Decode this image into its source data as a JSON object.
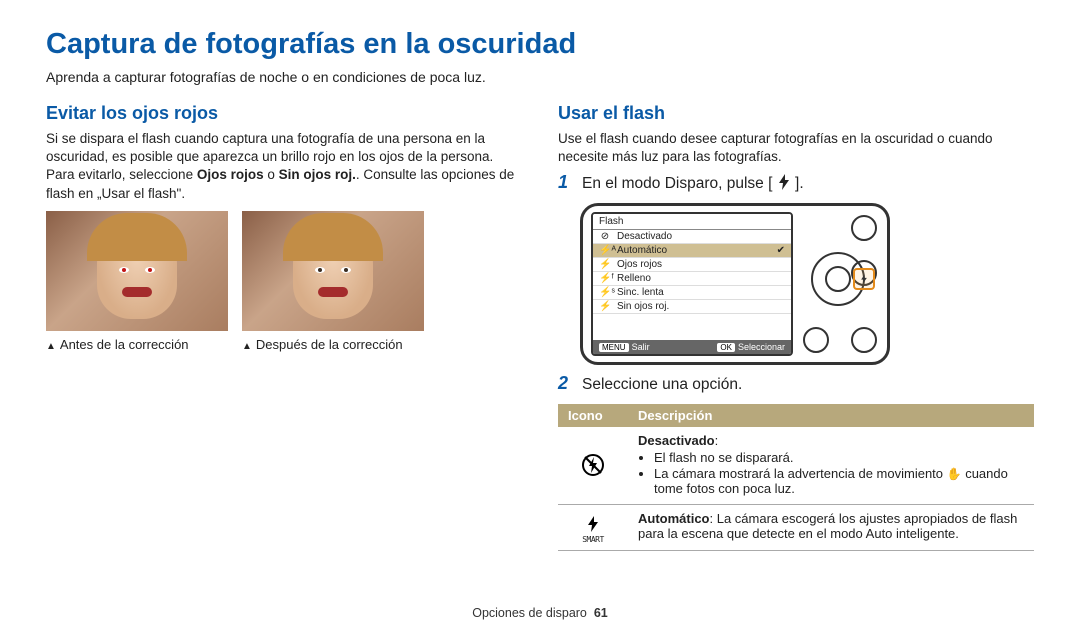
{
  "page_title": "Captura de fotografías en la oscuridad",
  "intro": "Aprenda a capturar fotografías de noche o en condiciones de poca luz.",
  "left": {
    "heading": "Evitar los ojos rojos",
    "p1a": "Si se dispara el flash cuando captura una fotografía de una persona en la oscuridad, es posible que aparezca un brillo rojo en los ojos de la persona. Para evitarlo, seleccione ",
    "p1b": "Ojos rojos",
    "p1c": " o ",
    "p1d": "Sin ojos roj.",
    "p1e": ". Consulte las opciones de flash en „Usar el flash\".",
    "caption_before": "Antes de la corrección",
    "caption_after": "Después de la corrección"
  },
  "right": {
    "heading": "Usar el flash",
    "p1": "Use el flash cuando desee capturar fotografías en la oscuridad o cuando necesite más luz para las fotografías.",
    "step1_num": "1",
    "step1_a": "En el modo Disparo, pulse [",
    "step1_b": "].",
    "step2_num": "2",
    "step2": "Seleccione una opción.",
    "lcd": {
      "title": "Flash",
      "rows": [
        {
          "label": "Desactivado",
          "selected": false
        },
        {
          "label": "Automático",
          "selected": true
        },
        {
          "label": "Ojos rojos",
          "selected": false
        },
        {
          "label": "Relleno",
          "selected": false
        },
        {
          "label": "Sinc. lenta",
          "selected": false
        },
        {
          "label": "Sin ojos roj.",
          "selected": false
        }
      ],
      "footer_left_tag": "MENU",
      "footer_left": "Salir",
      "footer_right_tag": "OK",
      "footer_right": "Seleccionar"
    },
    "table": {
      "h1": "Icono",
      "h2": "Descripción",
      "row1_title": "Desactivado",
      "row1_title_colon": ":",
      "row1_b1": "El flash no se disparará.",
      "row1_b2a": "La cámara mostrará la advertencia de movimiento ",
      "row1_b2b": " cuando tome fotos con poca luz.",
      "row2_title": "Automático",
      "row2_text": ": La cámara escogerá los ajustes apropiados de flash para la escena que detecte en el modo Auto inteligente.",
      "row2_smart": "SMART"
    }
  },
  "footer_section": "Opciones de disparo",
  "footer_page": "61"
}
